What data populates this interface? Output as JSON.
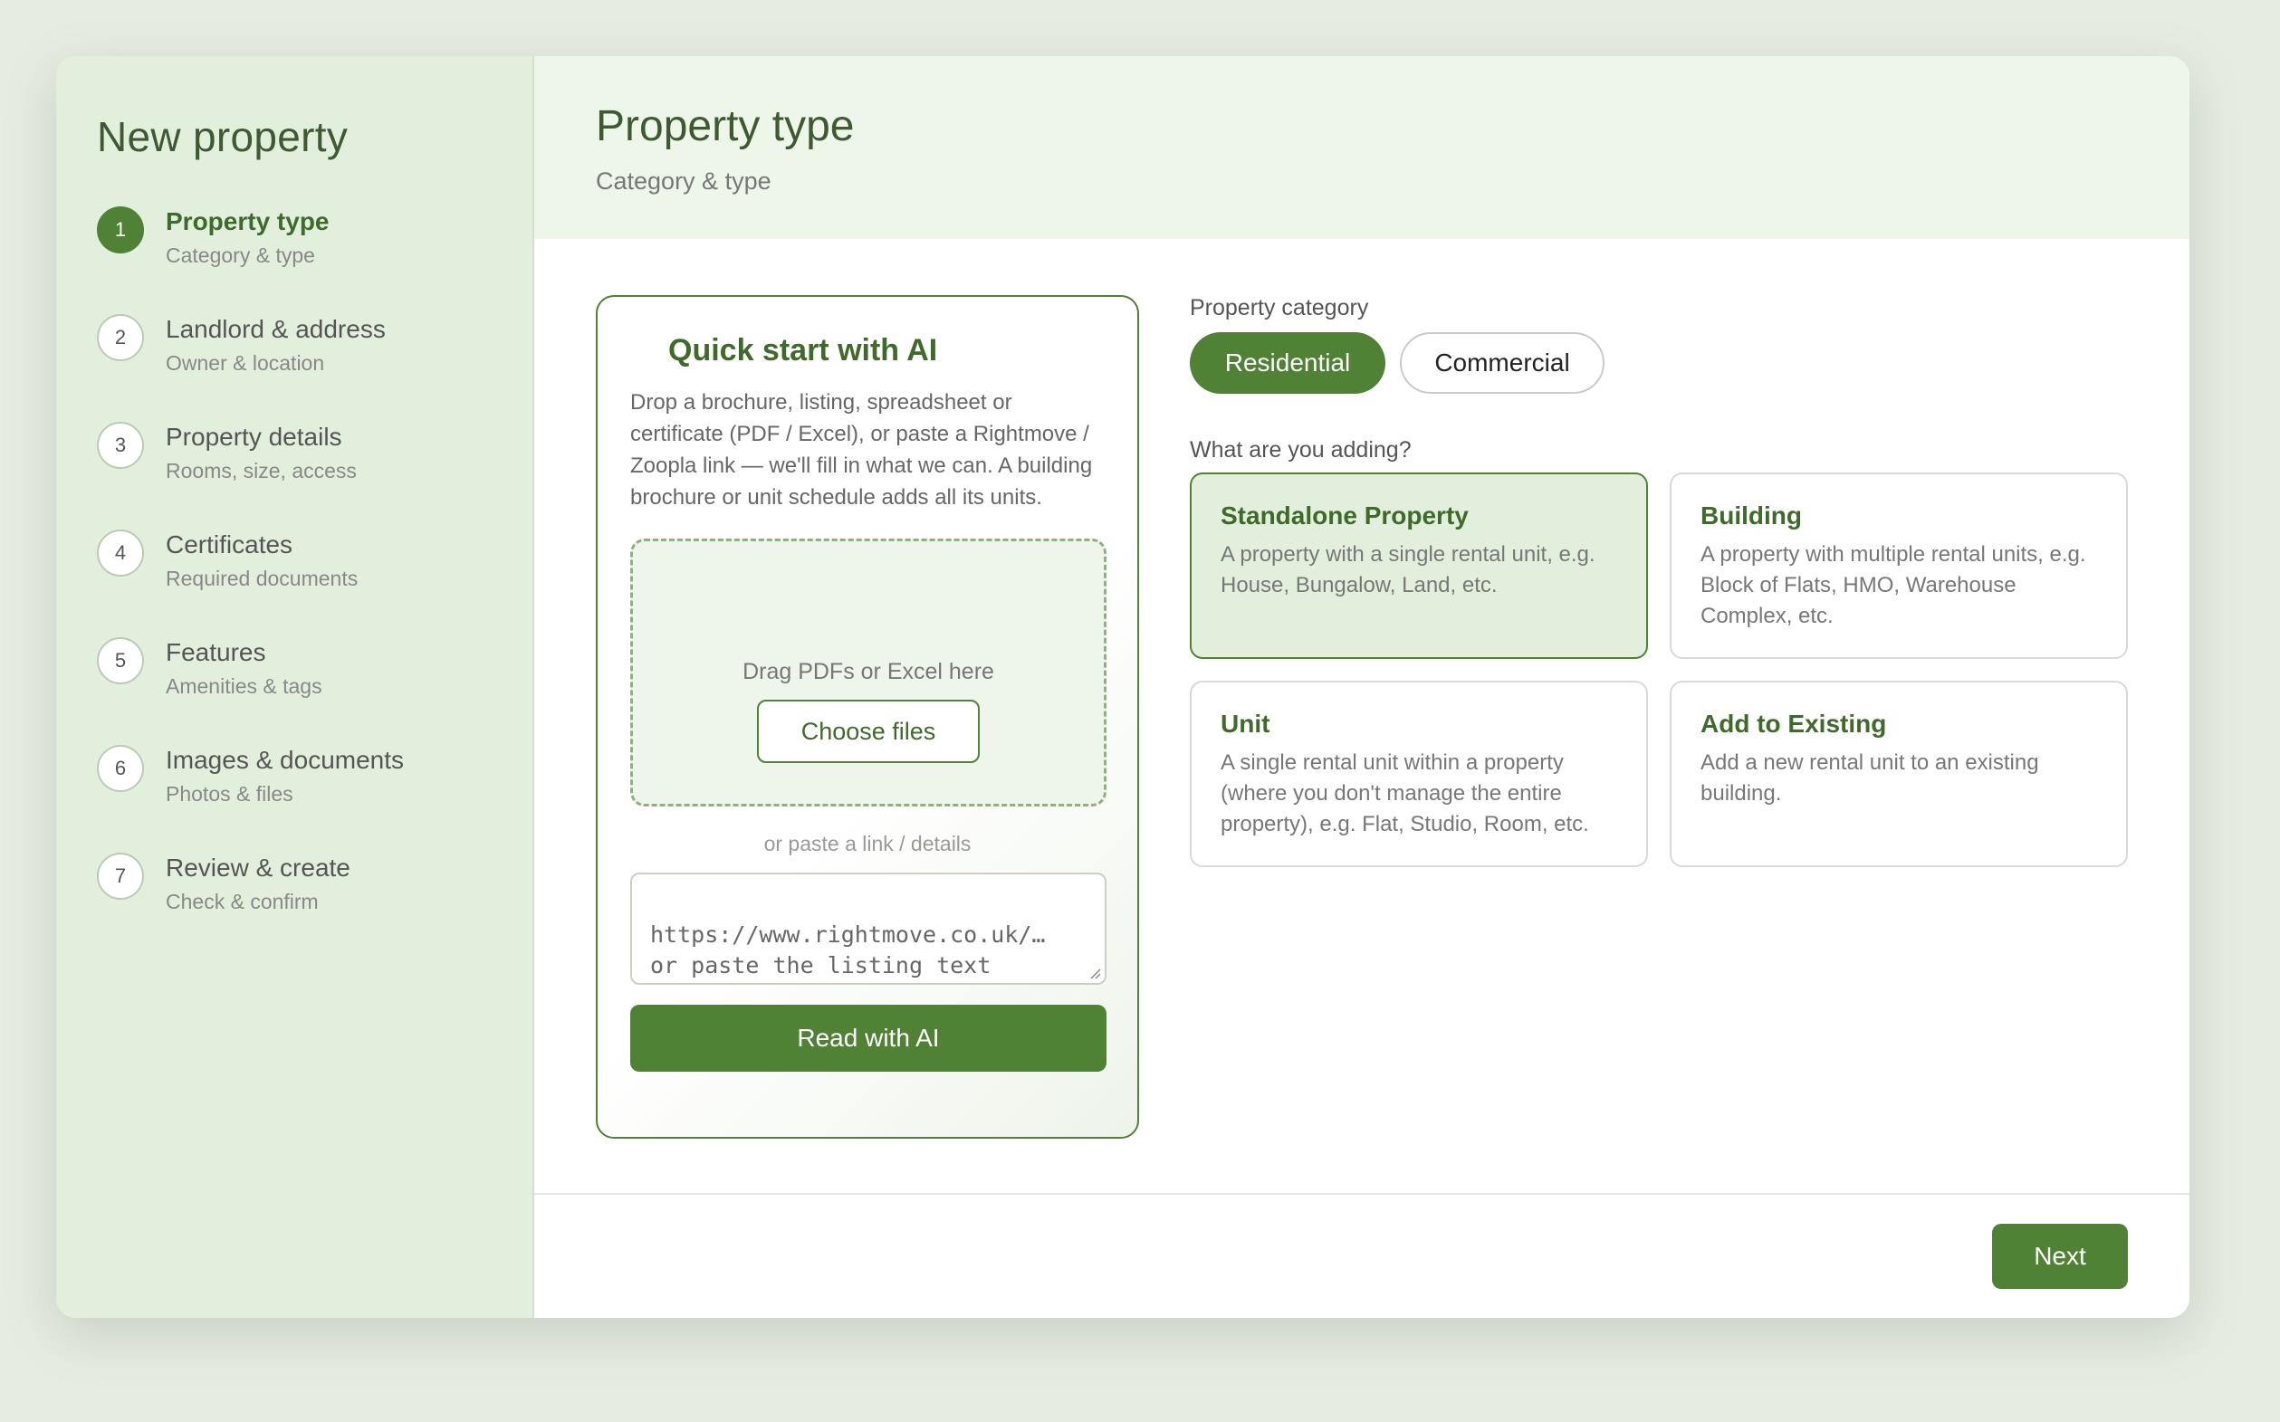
{
  "sidebar": {
    "title": "New property",
    "steps": [
      {
        "num": "1",
        "label": "Property type",
        "sub": "Category & type"
      },
      {
        "num": "2",
        "label": "Landlord & address",
        "sub": "Owner & location"
      },
      {
        "num": "3",
        "label": "Property details",
        "sub": "Rooms, size, access"
      },
      {
        "num": "4",
        "label": "Certificates",
        "sub": "Required documents"
      },
      {
        "num": "5",
        "label": "Features",
        "sub": "Amenities & tags"
      },
      {
        "num": "6",
        "label": "Images & documents",
        "sub": "Photos & files"
      },
      {
        "num": "7",
        "label": "Review & create",
        "sub": "Check & confirm"
      }
    ],
    "active_step": 1
  },
  "header": {
    "title": "Property type",
    "subtitle": "Category & type"
  },
  "ai_card": {
    "title": "Quick start with AI",
    "description": "Drop a brochure, listing, spreadsheet or certificate (PDF / Excel), or paste a Rightmove / Zoopla link — we'll fill in what we can. A building brochure or unit schedule adds all its units.",
    "drop_text": "Drag PDFs or Excel here",
    "choose_button": "Choose files",
    "or_text": "or paste a link / details",
    "link_placeholder": "https://www.rightmove.co.uk/…\nor paste the listing text",
    "read_button": "Read with AI"
  },
  "category": {
    "label": "Property category",
    "options": [
      "Residential",
      "Commercial"
    ],
    "selected": "Residential"
  },
  "adding": {
    "label": "What are you adding?",
    "options": [
      {
        "title": "Standalone Property",
        "desc": "A property with a single rental unit, e.g. House, Bungalow, Land, etc."
      },
      {
        "title": "Building",
        "desc": "A property with multiple rental units, e.g. Block of Flats, HMO, Warehouse Complex, etc."
      },
      {
        "title": "Unit",
        "desc": "A single rental unit within a property (where you don't manage the entire property), e.g. Flat, Studio, Room, etc."
      },
      {
        "title": "Add to Existing",
        "desc": "Add a new rental unit to an existing building."
      }
    ],
    "selected": "Standalone Property"
  },
  "footer": {
    "next_label": "Next"
  },
  "colors": {
    "accent": "#4f8234",
    "sidebar_bg": "#e3efdd",
    "header_bg": "#eef6ea",
    "page_bg": "#e6ece2"
  }
}
